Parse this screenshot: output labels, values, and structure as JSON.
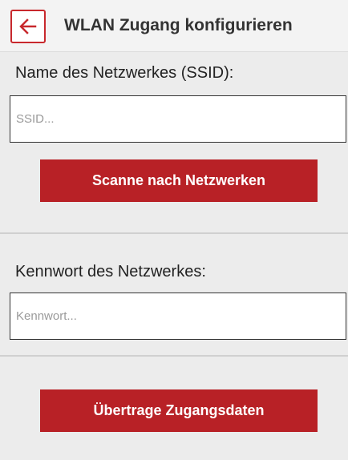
{
  "header": {
    "title": "WLAN Zugang konfigurieren",
    "back_icon": "arrow-left-icon",
    "accent_color": "#c8282d"
  },
  "ssid_section": {
    "label": "Name des Netzwerkes (SSID):",
    "input_value": "",
    "input_placeholder": "SSID...",
    "scan_button_label": "Scanne nach Netzwerken"
  },
  "password_section": {
    "label": "Kennwort des Netzwerkes:",
    "input_value": "",
    "input_placeholder": "Kennwort..."
  },
  "footer": {
    "submit_button_label": "Übertrage Zugangsdaten",
    "button_color": "#b82126"
  }
}
